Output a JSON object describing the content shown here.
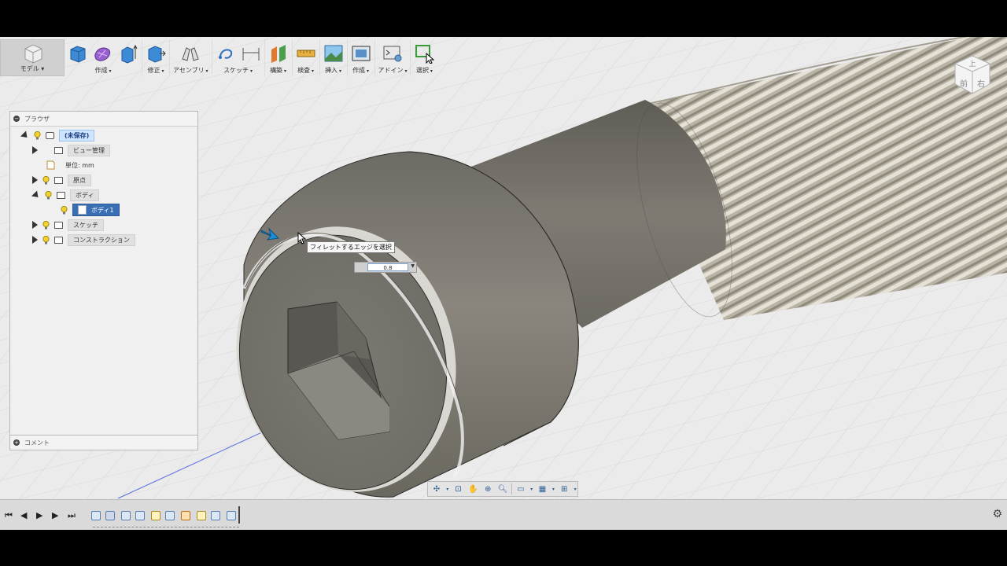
{
  "toolbar": {
    "workspace": "モデル",
    "groups": [
      "作成",
      "修正",
      "アセンブリ",
      "スケッチ",
      "構築",
      "検査",
      "挿入",
      "作成",
      "アドイン",
      "選択"
    ]
  },
  "viewcube": {
    "top": "上",
    "front": "前",
    "right": "右"
  },
  "browser": {
    "title": "ブラウザ",
    "items": [
      {
        "label": "(未保存)"
      },
      {
        "label": "ビュー管理"
      },
      {
        "label": "単位: mm"
      },
      {
        "label": "原点"
      },
      {
        "label": "ボディ"
      },
      {
        "label": "ボディ1"
      },
      {
        "label": "スケッチ"
      },
      {
        "label": "コンストラクション"
      }
    ]
  },
  "comment": {
    "label": "コメント"
  },
  "tooltip": {
    "text": "フィレットするエッジを選択"
  },
  "dimension": {
    "value": "0.8"
  },
  "colors": {
    "accent": "#3a6fb5",
    "model": "#7d7a73",
    "background": "#ebebeb",
    "thread": "#b9b3a6"
  }
}
